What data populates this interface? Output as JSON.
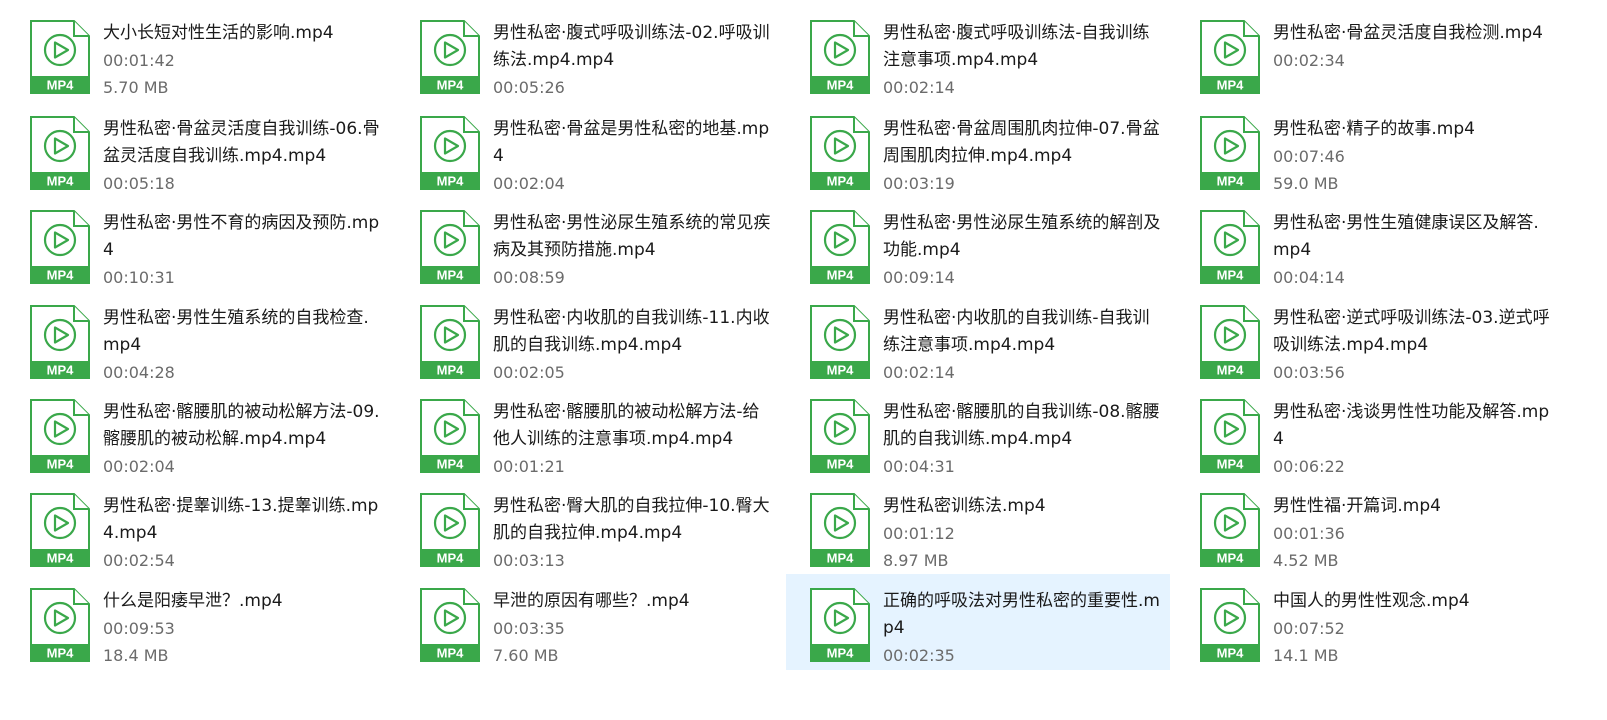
{
  "icon_name": "mp4-file-icon",
  "icon_label": "MP4",
  "colors": {
    "accent_green": "#3aa84a",
    "selection_bg": "#e5f3ff",
    "name_text": "#1a1a1a",
    "meta_text": "#6b6b6b"
  },
  "files": [
    {
      "name": "大小长短对性生活的影响.mp4",
      "duration": "00:01:42",
      "size": "5.70 MB"
    },
    {
      "name": "男性私密·腹式呼吸训练法-02.呼吸训练法.mp4.mp4",
      "duration": "00:05:26"
    },
    {
      "name": "男性私密·腹式呼吸训练法-自我训练注意事项.mp4.mp4",
      "duration": "00:02:14"
    },
    {
      "name": "男性私密·骨盆灵活度自我检测.mp4",
      "duration": "00:02:34"
    },
    {
      "name": "男性私密·骨盆灵活度自我训练-06.骨盆灵活度自我训练.mp4.mp4",
      "duration": "00:05:18"
    },
    {
      "name": "男性私密·骨盆是男性私密的地基.mp4",
      "duration": "00:02:04"
    },
    {
      "name": "男性私密·骨盆周围肌肉拉伸-07.骨盆周围肌肉拉伸.mp4.mp4",
      "duration": "00:03:19"
    },
    {
      "name": "男性私密·精子的故事.mp4",
      "duration": "00:07:46",
      "size": "59.0 MB"
    },
    {
      "name": "男性私密·男性不育的病因及预防.mp4",
      "duration": "00:10:31"
    },
    {
      "name": "男性私密·男性泌尿生殖系统的常见疾病及其预防措施.mp4",
      "duration": "00:08:59"
    },
    {
      "name": "男性私密·男性泌尿生殖系统的解剖及功能.mp4",
      "duration": "00:09:14"
    },
    {
      "name": "男性私密·男性生殖健康误区及解答.mp4",
      "duration": "00:04:14"
    },
    {
      "name": "男性私密·男性生殖系统的自我检查.mp4",
      "duration": "00:04:28"
    },
    {
      "name": "男性私密·内收肌的自我训练-11.内收肌的自我训练.mp4.mp4",
      "duration": "00:02:05"
    },
    {
      "name": "男性私密·内收肌的自我训练-自我训练注意事项.mp4.mp4",
      "duration": "00:02:14"
    },
    {
      "name": "男性私密·逆式呼吸训练法-03.逆式呼吸训练法.mp4.mp4",
      "duration": "00:03:56"
    },
    {
      "name": "男性私密·髂腰肌的被动松解方法-09.髂腰肌的被动松解.mp4.mp4",
      "duration": "00:02:04"
    },
    {
      "name": "男性私密·髂腰肌的被动松解方法-给他人训练的注意事项.mp4.mp4",
      "duration": "00:01:21"
    },
    {
      "name": "男性私密·髂腰肌的自我训练-08.髂腰肌的自我训练.mp4.mp4",
      "duration": "00:04:31"
    },
    {
      "name": "男性私密·浅谈男性性功能及解答.mp4",
      "duration": "00:06:22"
    },
    {
      "name": "男性私密·提睾训练-13.提睾训练.mp4.mp4",
      "duration": "00:02:54"
    },
    {
      "name": "男性私密·臀大肌的自我拉伸-10.臀大肌的自我拉伸.mp4.mp4",
      "duration": "00:03:13"
    },
    {
      "name": "男性私密训练法.mp4",
      "duration": "00:01:12",
      "size": "8.97 MB"
    },
    {
      "name": "男性性福·开篇词.mp4",
      "duration": "00:01:36",
      "size": "4.52 MB"
    },
    {
      "name": "什么是阳痿早泄？.mp4",
      "duration": "00:09:53",
      "size": "18.4 MB"
    },
    {
      "name": "早泄的原因有哪些？.mp4",
      "duration": "00:03:35",
      "size": "7.60 MB"
    },
    {
      "name": "正确的呼吸法对男性私密的重要性.mp4",
      "duration": "00:02:35",
      "selected": true
    },
    {
      "name": "中国人的男性性观念.mp4",
      "duration": "00:07:52",
      "size": "14.1 MB"
    }
  ]
}
